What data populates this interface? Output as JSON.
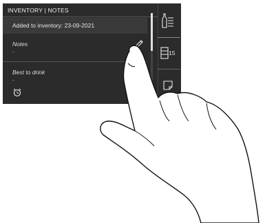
{
  "header": {
    "title": "INVENTORY | NOTES"
  },
  "rows": {
    "added": "Added to inventory: 23-09-2021",
    "notes_label": "Notes",
    "notes_value": "-",
    "best_label": "Best to drink",
    "best_value": "-"
  },
  "side": {
    "count": "15"
  },
  "icons": {
    "edit": "pencil-icon",
    "alarm": "alarm-clock-icon",
    "bottle": "bottle-list-icon",
    "rack": "rack-icon",
    "note": "note-icon"
  },
  "colors": {
    "panel": "#2b2b2b",
    "row": "#3a3a3a",
    "text": "#e8e8e8"
  }
}
